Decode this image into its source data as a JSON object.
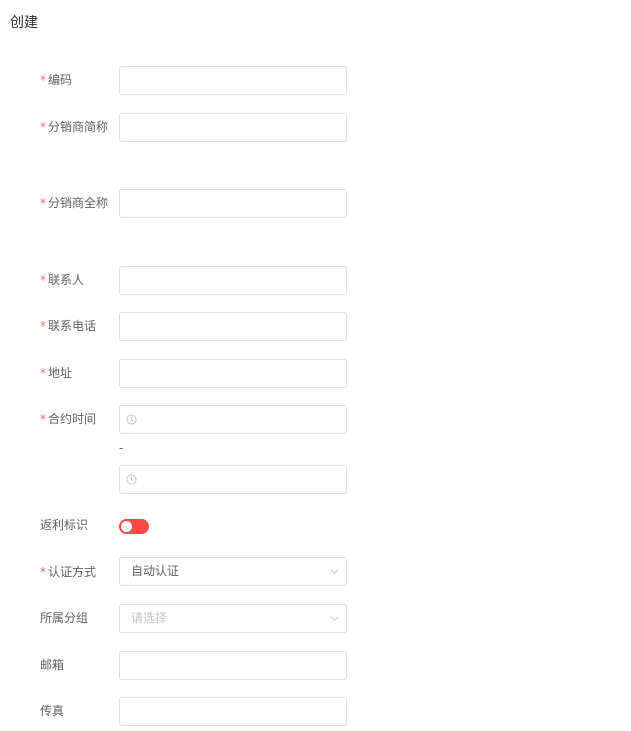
{
  "page": {
    "title": "创建"
  },
  "form": {
    "code": {
      "label": "编码",
      "required": true,
      "value": ""
    },
    "short_name": {
      "label": "分销商简称",
      "required": true,
      "value": ""
    },
    "full_name": {
      "label": "分销商全称",
      "required": true,
      "value": ""
    },
    "contact": {
      "label": "联系人",
      "required": true,
      "value": ""
    },
    "phone": {
      "label": "联系电话",
      "required": true,
      "value": ""
    },
    "address": {
      "label": "地址",
      "required": true,
      "value": ""
    },
    "contract_time": {
      "label": "合约时间",
      "required": true,
      "separator": "-",
      "start": "",
      "end": ""
    },
    "rebate": {
      "label": "返利标识",
      "required": false,
      "enabled": false
    },
    "auth_method": {
      "label": "认证方式",
      "required": true,
      "value": "自动认证"
    },
    "group": {
      "label": "所属分组",
      "required": false,
      "placeholder": "请选择"
    },
    "email": {
      "label": "邮箱",
      "required": false,
      "value": ""
    },
    "fax": {
      "label": "传真",
      "required": false,
      "value": ""
    }
  },
  "icons": {
    "clock": "clock-icon",
    "chevron": "chevron-down-icon"
  },
  "colors": {
    "required_star": "#f56c6c",
    "switch_off": "#ff4949",
    "border": "#dcdfe6"
  }
}
